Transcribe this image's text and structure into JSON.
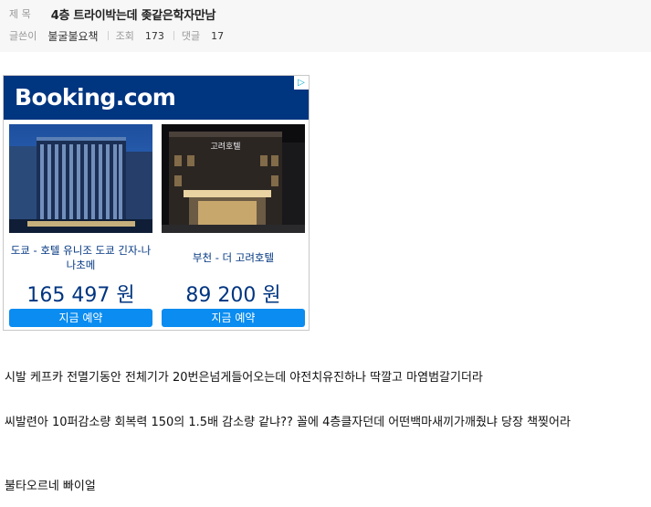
{
  "header": {
    "title_label": "제 목",
    "title": "4층 트라이박는데 좆같은학자만남",
    "author_label": "글쓴이",
    "author": "불굴불요책",
    "views_label": "조회",
    "views": "173",
    "comments_label": "댓글",
    "comments": "17"
  },
  "ad": {
    "brand": "Booking.com",
    "brand_color": "#003580",
    "hotels": [
      {
        "name": "도쿄 - 호텔 유니조 도쿄 긴자-나나초메",
        "price": "165 497 원",
        "cta": "지금 예약"
      },
      {
        "name": "부천 - 더 고려호텔",
        "price": "89 200 원",
        "cta": "지금 예약"
      }
    ],
    "hotel2_sign": "고려호텔"
  },
  "body": {
    "paragraphs": [
      "시발 케프카 전멸기동안 전체기가 20번은넘게들어오는데 야전치유진하나 딱깔고 마염범갈기더라",
      "씨발련아 10퍼감소량 회복력 150의 1.5배 감소량 같냐?? 꼴에 4층클자던데 어떤백마새끼가깨줬냐 당장 책찢어라",
      "불타오르네 빠이얼"
    ]
  }
}
